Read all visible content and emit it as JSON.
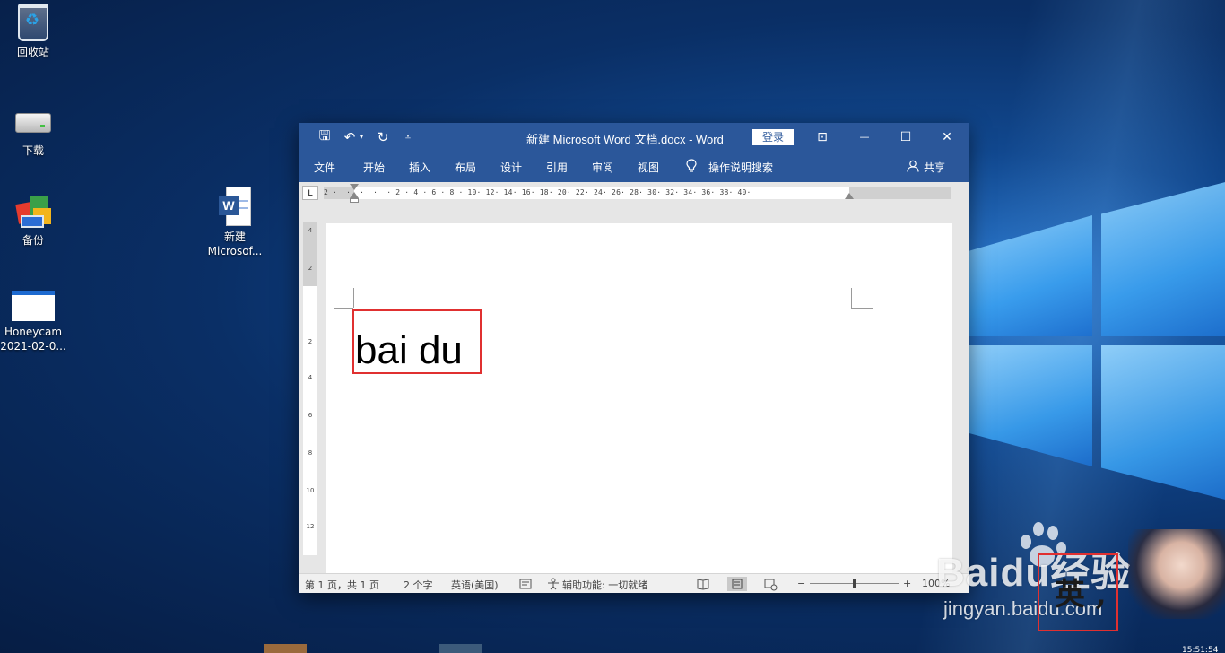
{
  "desktop": {
    "icons": [
      {
        "label": "回收站"
      },
      {
        "label": "下载"
      },
      {
        "label": "备份"
      },
      {
        "label": "Honeycam 2021-02-0..."
      },
      {
        "label": "新建 Microsof..."
      }
    ]
  },
  "word": {
    "title": "新建 Microsoft Word 文档.docx  -  Word",
    "login_label": "登录",
    "qa_icons": [
      "save-icon",
      "undo-icon",
      "redo-icon",
      "customize-icon"
    ],
    "qa_glyphs": {
      "save": "🖫",
      "undo": "↶",
      "undo_drop": "▾",
      "redo": "↻",
      "customize": "⩡"
    },
    "window_glyphs": {
      "ribbon_options": "⊡",
      "minimize": "—",
      "maximize": "☐",
      "close": "✕"
    },
    "tabs": [
      "文件",
      "开始",
      "插入",
      "布局",
      "设计",
      "引用",
      "审阅",
      "视图"
    ],
    "search_label": "操作说明搜索",
    "share_label": "共享",
    "ruler_corner": "L",
    "hruler_marks": "2 ·  ·  ·  ·  · 2 · 4 · 6 · 8 · 10· 12· 14· 16· 18· 20· 22· 24· 26· 28· 30· 32· 34· 36· 38· 40·",
    "vruler_labels": [
      "4",
      "2",
      "2",
      "4",
      "6",
      "8",
      "10",
      "12"
    ],
    "document_text": "bai du",
    "status": {
      "page": "第 1 页，共 1 页",
      "words": "2 个字",
      "language": "英语(美国)",
      "accessibility": "辅助功能: 一切就绪",
      "zoom_minus": "−",
      "zoom_plus": "+",
      "zoom": "100%"
    }
  },
  "watermark": {
    "baidu": "Baidu经验",
    "site": "jingyan.baidu.com"
  },
  "ime": {
    "chars": "英 ,"
  },
  "clock": "15:51:54"
}
